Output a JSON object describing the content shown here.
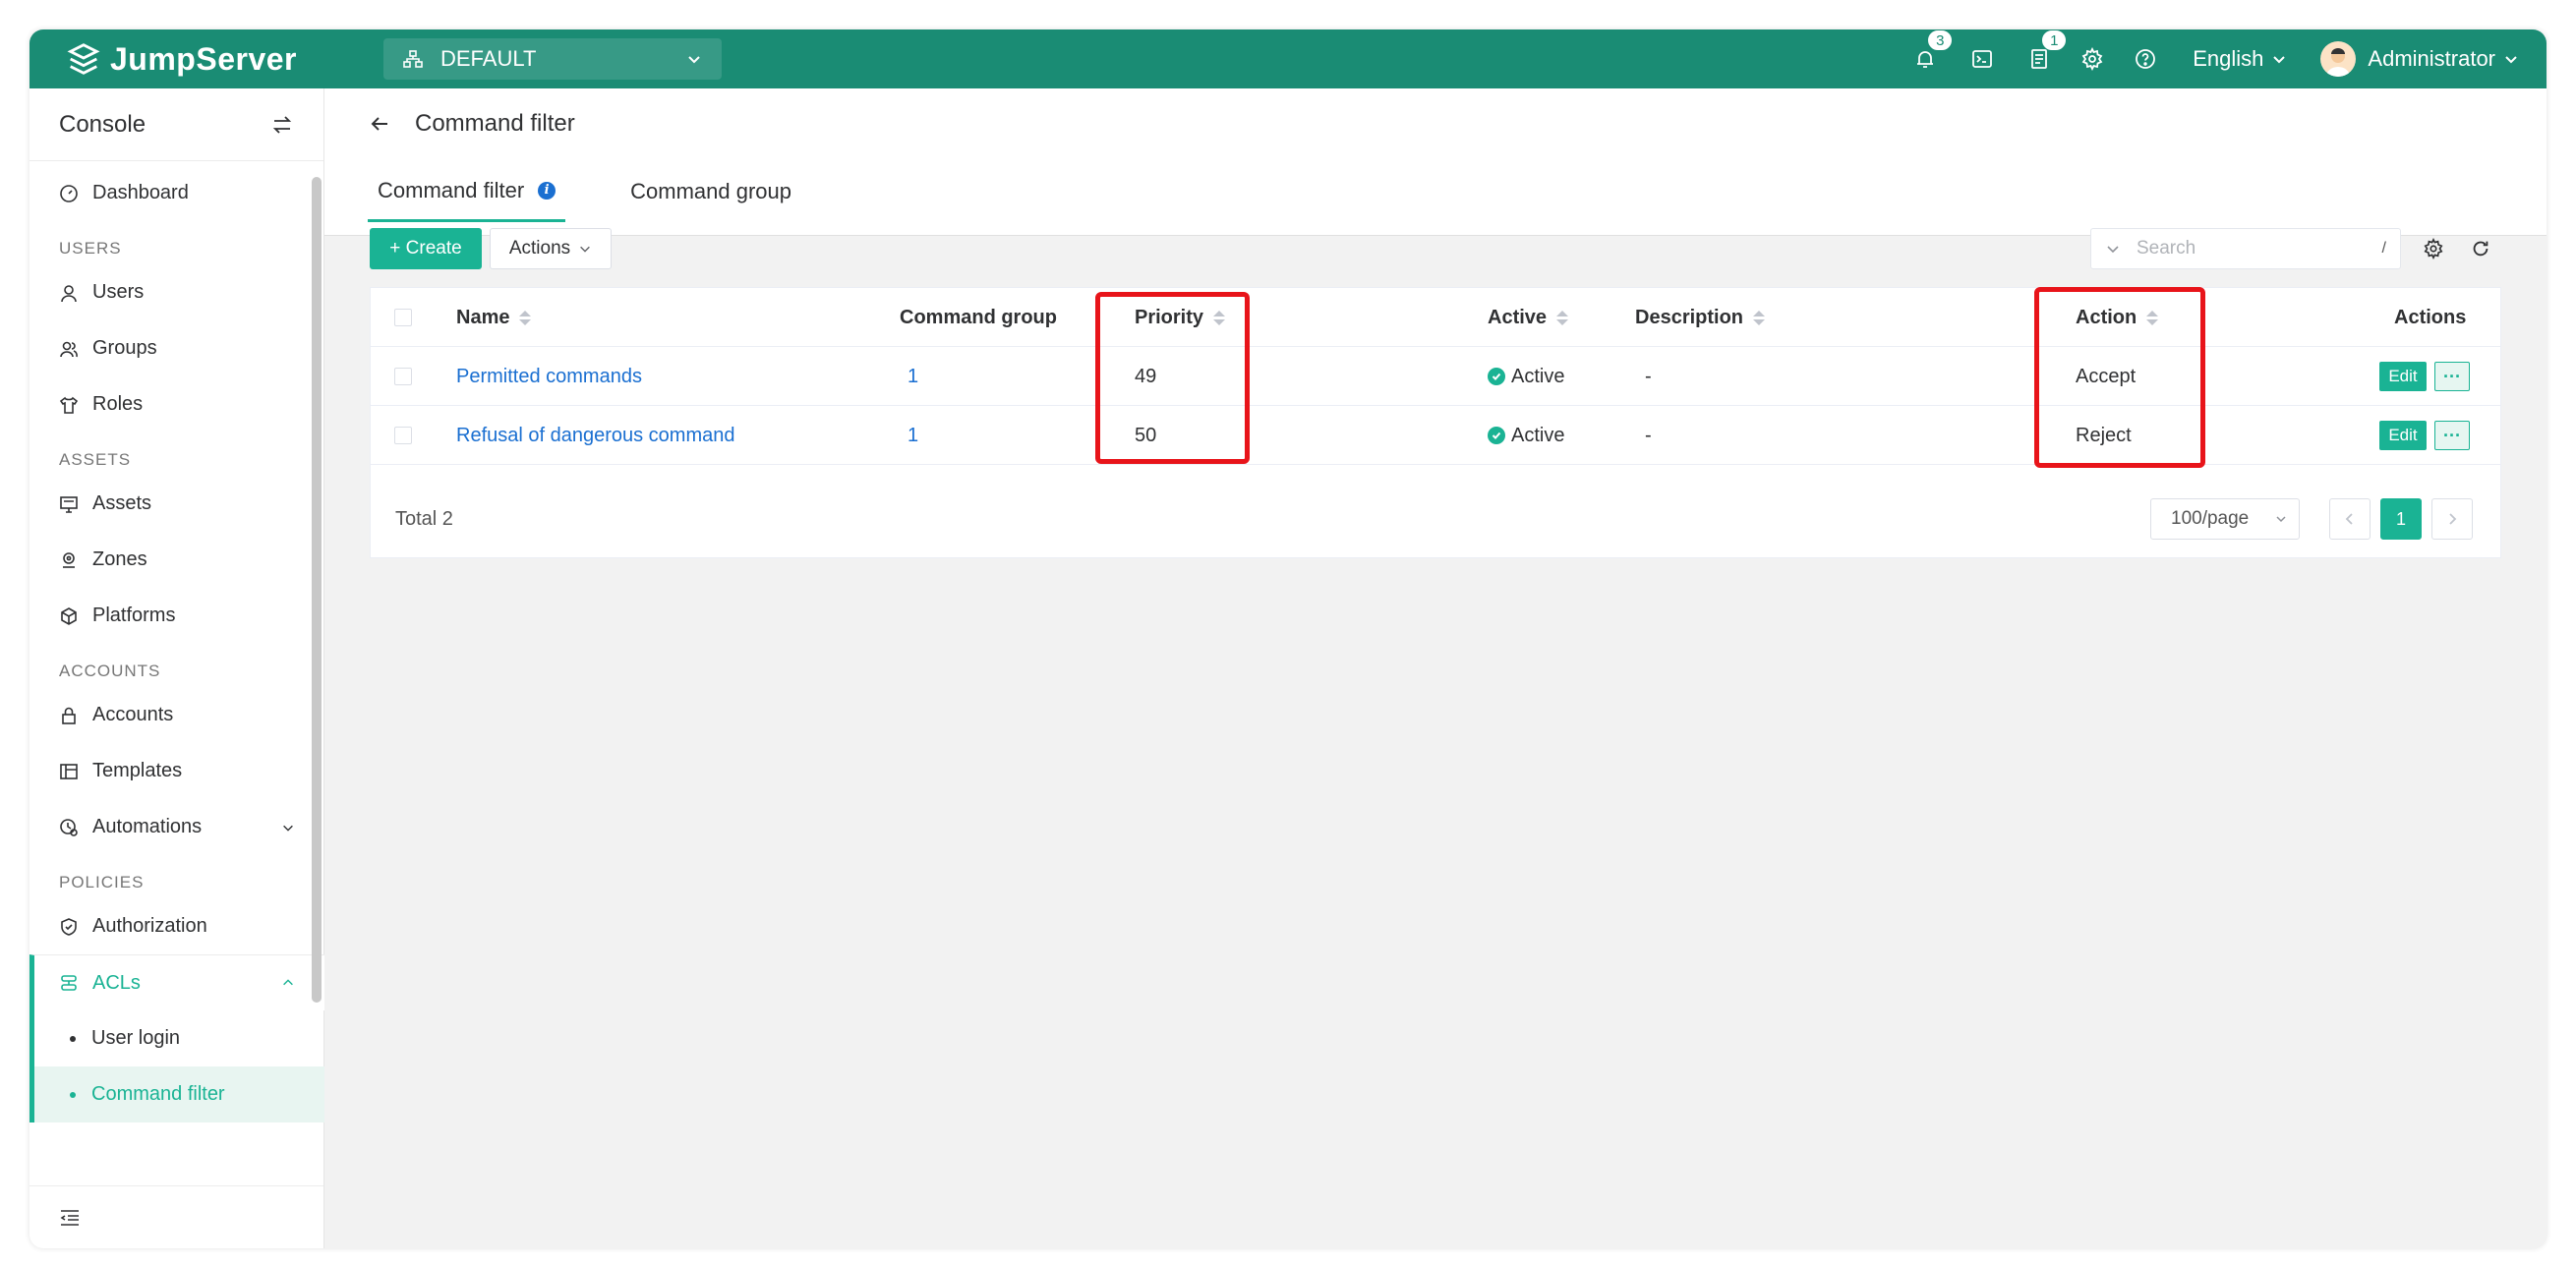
{
  "header": {
    "brand": "JumpServer",
    "org": "DEFAULT",
    "notification_count": "3",
    "ticket_count": "1",
    "language": "English",
    "user": "Administrator",
    "brand_color": "#1a8c74"
  },
  "sidebar": {
    "title": "Console",
    "groups": {
      "users": "USERS",
      "assets": "ASSETS",
      "accounts": "ACCOUNTS",
      "policies": "POLICIES"
    },
    "items": {
      "dashboard": "Dashboard",
      "users": "Users",
      "groups": "Groups",
      "roles": "Roles",
      "assets": "Assets",
      "zones": "Zones",
      "platforms": "Platforms",
      "accounts": "Accounts",
      "templates": "Templates",
      "automations": "Automations",
      "authorization": "Authorization",
      "acls": "ACLs",
      "user_login": "User login",
      "command_filter": "Command filter"
    }
  },
  "page": {
    "title": "Command filter",
    "tabs": [
      "Command filter",
      "Command group"
    ]
  },
  "toolbar": {
    "create_label": "+ Create",
    "actions_label": "Actions",
    "search_placeholder": "Search",
    "search_hint": "/"
  },
  "table": {
    "columns": {
      "name": "Name",
      "command_group": "Command group",
      "priority": "Priority",
      "active": "Active",
      "description": "Description",
      "action": "Action",
      "actions": "Actions"
    },
    "rows": [
      {
        "name": "Permitted commands",
        "command_group": "1",
        "priority": "49",
        "active": "Active",
        "description": "-",
        "action": "Accept",
        "edit": "Edit",
        "more": "···"
      },
      {
        "name": "Refusal of dangerous command",
        "command_group": "1",
        "priority": "50",
        "active": "Active",
        "description": "-",
        "action": "Reject",
        "edit": "Edit",
        "more": "···"
      }
    ],
    "total": "Total 2",
    "page_size": "100/page",
    "current_page": "1"
  }
}
